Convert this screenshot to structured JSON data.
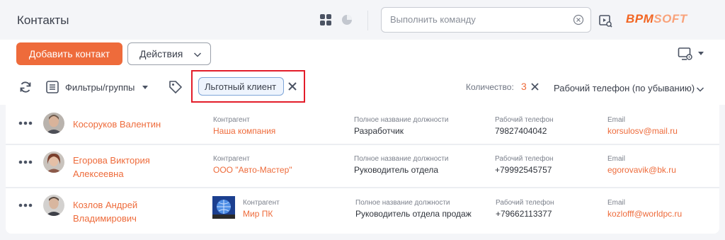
{
  "header": {
    "title": "Контакты",
    "command_placeholder": "Выполнить команду",
    "logo": {
      "main": "BPM",
      "accent": "SOFT"
    }
  },
  "actions": {
    "add_label": "Добавить контакт",
    "actions_label": "Действия"
  },
  "filters": {
    "filters_label": "Фильтры/группы",
    "tag_chip": "Льготный клиент",
    "count_label": "Количество:",
    "count_value": "3",
    "sort_label": "Рабочий телефон (по убыванию)"
  },
  "columns": {
    "account": "Контрагент",
    "job": "Полное название должности",
    "phone": "Рабочий телефон",
    "email": "Email"
  },
  "contacts": [
    {
      "name_line1": "Косоруков Валентин",
      "name_line2": "",
      "account": "Наша компания",
      "job": "Разработчик",
      "phone": "79827404042",
      "email": "korsulosv@mail.ru"
    },
    {
      "name_line1": "Егорова Виктория",
      "name_line2": "Алексеевна",
      "account": "ООО \"Авто-Мастер\"",
      "job": "Руководитель отдела",
      "phone": "+79992545757",
      "email": "egorovavik@bk.ru"
    },
    {
      "name_line1": "Козлов Андрей",
      "name_line2": "Владимирович",
      "account": "Мир ПК",
      "job": "Руководитель отдела продаж",
      "phone": "+79662113377",
      "email": "kozlofff@worldpc.ru"
    }
  ],
  "colors": {
    "accent": "#ee6b3b",
    "highlight": "#e31d2a",
    "chip_border": "#7ea5d8"
  },
  "icons": [
    "tiles-view-icon",
    "chart-view-icon",
    "clear-icon",
    "play-icon",
    "settings-icon",
    "refresh-icon",
    "filters-icon",
    "tag-icon",
    "close-icon",
    "chevron-down-icon",
    "more-icon"
  ]
}
